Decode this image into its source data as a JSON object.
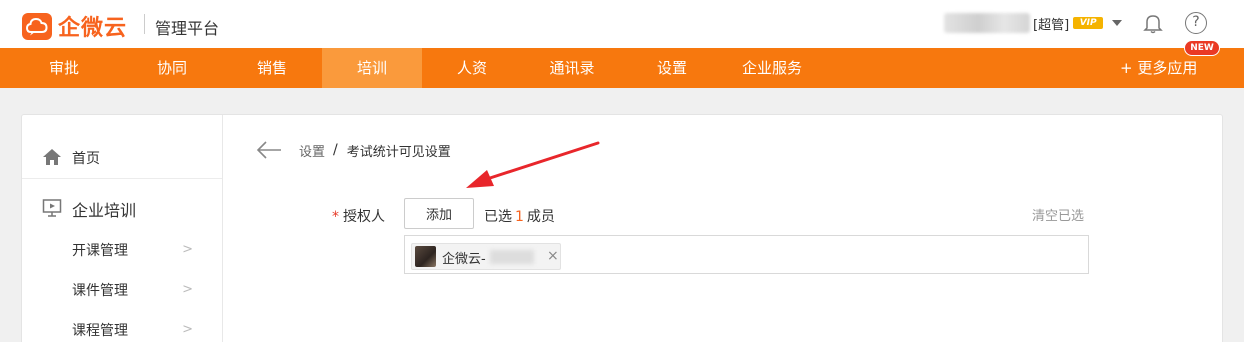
{
  "header": {
    "logo_text": "企微云",
    "platform_title": "管理平台",
    "user_role": "[超管]",
    "vip_badge": "VIP",
    "help_glyph": "?"
  },
  "nav": {
    "items": [
      {
        "label": "审批"
      },
      {
        "label": "协同"
      },
      {
        "label": "销售"
      },
      {
        "label": "培训",
        "active": true
      },
      {
        "label": "人资"
      },
      {
        "label": "通讯录"
      },
      {
        "label": "设置"
      },
      {
        "label": "企业服务"
      }
    ],
    "more_apps": "+ 更多应用",
    "new_badge": "NEW"
  },
  "sidebar": {
    "home": "首页",
    "group": "企业培训",
    "subitems": [
      {
        "label": "开课管理"
      },
      {
        "label": "课件管理"
      },
      {
        "label": "课程管理"
      }
    ]
  },
  "breadcrumb": {
    "parent": "设置",
    "separator": "/",
    "current": "考试统计可见设置"
  },
  "form": {
    "required_mark": "*",
    "label": "授权人",
    "add_button": "添加",
    "selected_prefix": "已选",
    "selected_count": "1",
    "selected_suffix": "成员",
    "clear_link": "清空已选",
    "members": [
      {
        "name": "企微云-"
      }
    ],
    "remove_glyph": "×"
  },
  "colors": {
    "brand": "#f7631e",
    "nav_bg": "#f7780e",
    "nav_active": "#fa9a3c",
    "annotation_arrow": "#e8262b"
  }
}
